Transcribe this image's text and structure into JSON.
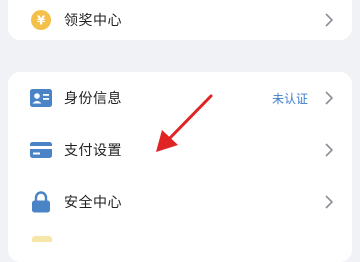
{
  "top_card": {
    "label": "领奖中心",
    "icon": "yen-coin-icon"
  },
  "menu": {
    "items": [
      {
        "label": "身份信息",
        "status": "未认证",
        "icon": "id-card-icon"
      },
      {
        "label": "支付设置",
        "status": "",
        "icon": "credit-card-icon"
      },
      {
        "label": "安全中心",
        "status": "",
        "icon": "lock-icon"
      }
    ]
  },
  "colors": {
    "background": "#f1f2f5",
    "card": "#ffffff",
    "accent_blue": "#4a83c6",
    "coin": "#f4c04a",
    "status_text": "#3d7ec9",
    "annotation_arrow": "#e02424"
  }
}
